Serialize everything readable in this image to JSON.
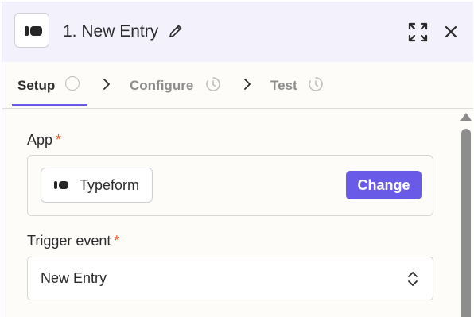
{
  "header": {
    "title": "1. New Entry",
    "logo_icon": "typeform-logo-icon",
    "edit_icon": "pencil-icon",
    "expand_icon": "expand-icon",
    "close_icon": "close-icon"
  },
  "tabs": [
    {
      "label": "Setup",
      "status_icon": "empty-circle-icon",
      "active": true
    },
    {
      "label": "Configure",
      "status_icon": "clock-icon",
      "active": false
    },
    {
      "label": "Test",
      "status_icon": "clock-icon",
      "active": false
    }
  ],
  "form": {
    "app": {
      "label": "App",
      "required_mark": "*",
      "value": "Typeform",
      "change_label": "Change"
    },
    "trigger_event": {
      "label": "Trigger event",
      "required_mark": "*",
      "value": "New Entry"
    }
  },
  "colors": {
    "accent": "#695be8",
    "required": "#e8541c",
    "header_bg": "#f3f1fb"
  }
}
